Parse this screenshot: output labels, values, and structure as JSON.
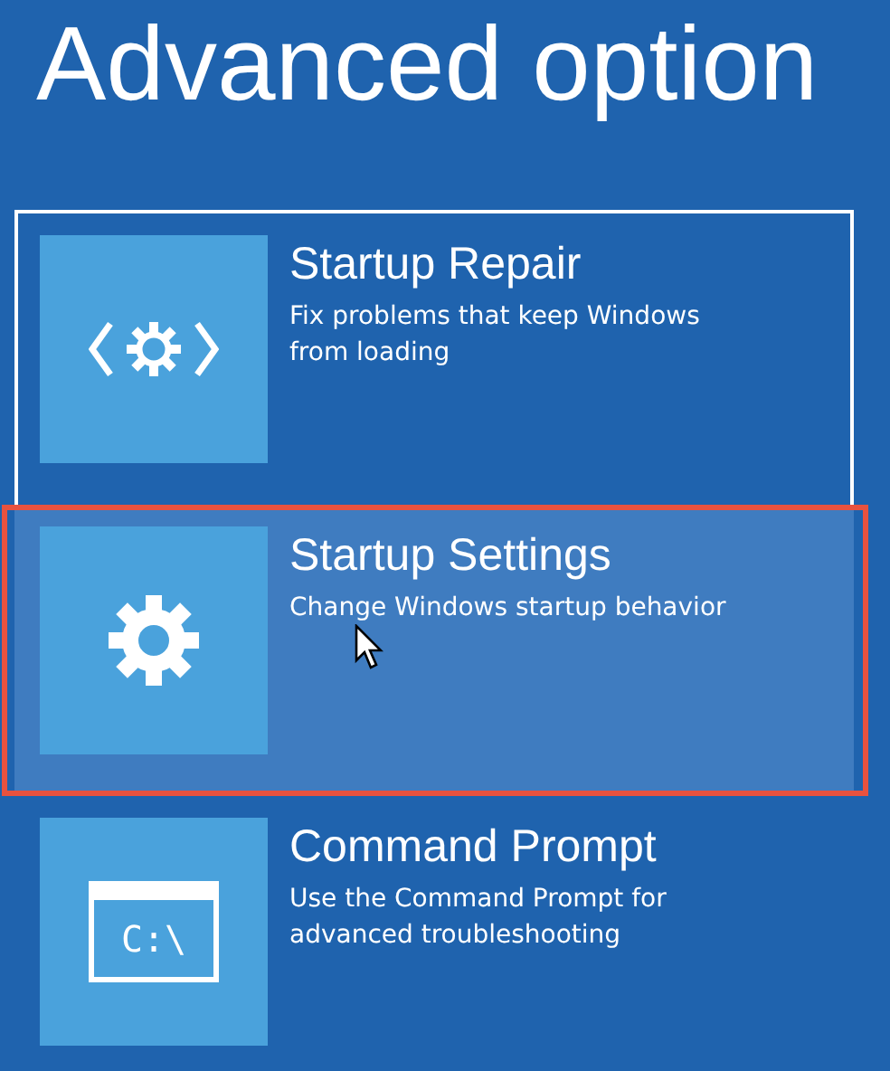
{
  "title": "Advanced option",
  "options": [
    {
      "kind": "repair",
      "name": "Startup Repair",
      "description": "Fix problems that keep Windows from loading",
      "focused": true,
      "hovered": false,
      "annotated": false
    },
    {
      "kind": "gear",
      "name": "Startup Settings",
      "description": "Change Windows startup behavior",
      "focused": false,
      "hovered": true,
      "annotated": true
    },
    {
      "kind": "console",
      "name": "Command Prompt",
      "description": "Use the Command Prompt for advanced troubleshooting",
      "icon_text": "C:\\",
      "focused": false,
      "hovered": false,
      "annotated": false
    }
  ]
}
